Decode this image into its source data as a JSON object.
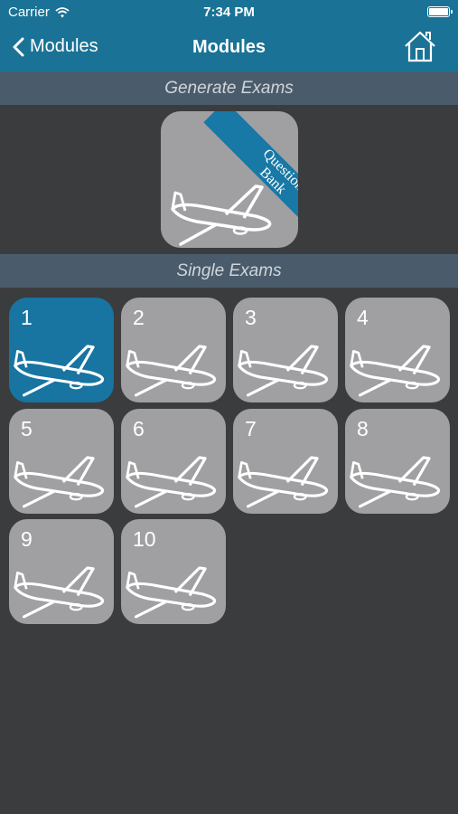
{
  "status": {
    "carrier": "Carrier",
    "time": "7:34 PM"
  },
  "nav": {
    "back_label": "Modules",
    "title": "Modules"
  },
  "sections": {
    "generate": "Generate Exams",
    "single": "Single Exams"
  },
  "question_bank": {
    "ribbon_line1": "Question",
    "ribbon_line2": "Bank"
  },
  "exams": [
    {
      "label": "1",
      "selected": true
    },
    {
      "label": "2",
      "selected": false
    },
    {
      "label": "3",
      "selected": false
    },
    {
      "label": "4",
      "selected": false
    },
    {
      "label": "5",
      "selected": false
    },
    {
      "label": "6",
      "selected": false
    },
    {
      "label": "7",
      "selected": false
    },
    {
      "label": "8",
      "selected": false
    },
    {
      "label": "9",
      "selected": false
    },
    {
      "label": "10",
      "selected": false
    }
  ],
  "icons": [
    "wifi-icon",
    "battery-icon",
    "back-chevron-icon",
    "home-icon",
    "airplane-icon"
  ],
  "colors": {
    "header": "#1a7396",
    "background": "#3b3c3e",
    "tile": "#a0a0a2",
    "tile_selected": "#1874a0",
    "section_bar": "#4a5c6c"
  }
}
